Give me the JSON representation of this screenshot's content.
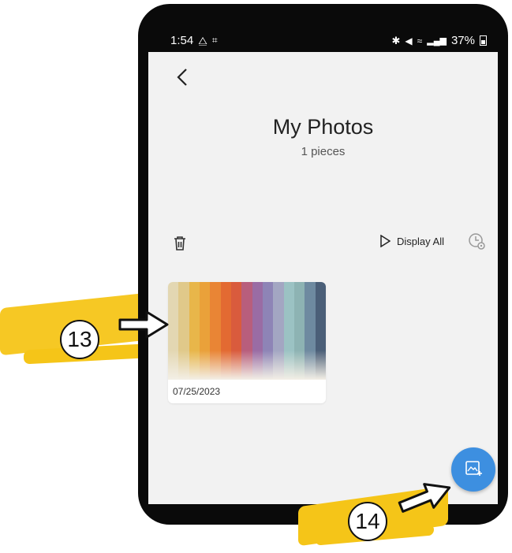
{
  "status_bar": {
    "time": "1:54",
    "battery": "37%"
  },
  "header": {
    "title": "My Photos",
    "subtitle": "1 pieces"
  },
  "toolbar": {
    "display_all_label": "Display All"
  },
  "photos": [
    {
      "date": "07/25/2023"
    }
  ],
  "thumbnail_colors": [
    "#e3d7b2",
    "#e0c98a",
    "#e8b64a",
    "#eaa13a",
    "#e98535",
    "#e36a32",
    "#d95b3d",
    "#b85e7c",
    "#9a6ca4",
    "#8e84b6",
    "#a3a6c2",
    "#9bc2c3",
    "#8db3b3",
    "#6e8aa0",
    "#4b5f78"
  ],
  "annotations": {
    "step_a": "13",
    "step_b": "14"
  },
  "colors": {
    "fab": "#3d8fe0",
    "highlight": "#f5c518",
    "screen_bg": "#f2f2f2"
  }
}
